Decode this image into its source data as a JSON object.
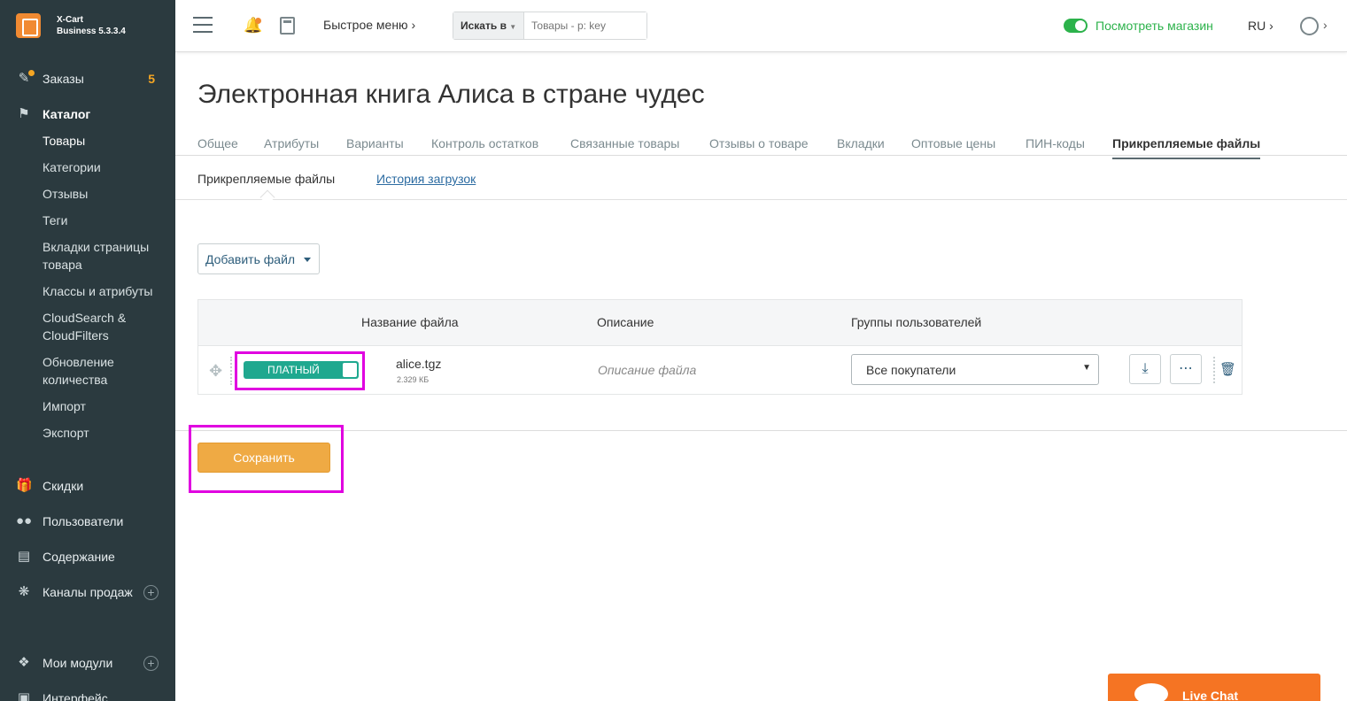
{
  "brand": {
    "line1": "X-Cart",
    "line2": "Business 5.3.3.4"
  },
  "sidebar": {
    "orders": {
      "label": "Заказы",
      "count": "5"
    },
    "catalog": {
      "label": "Каталог"
    },
    "catalog_items": [
      "Товары",
      "Категории",
      "Отзывы",
      "Теги",
      "Вкладки страницы товара",
      "Классы и атрибуты",
      "CloudSearch & CloudFilters",
      "Обновление количества",
      "Импорт",
      "Экспорт"
    ],
    "discounts": "Скидки",
    "users": "Пользователи",
    "content": "Содержание",
    "channels": "Каналы продаж",
    "modules": "Мои модули",
    "interface": "Интерфейс"
  },
  "topbar": {
    "quick_menu": "Быстрое меню",
    "search_in": "Искать в",
    "search_placeholder": "Товары - p: key",
    "view_store": "Посмотреть магазин",
    "lang": "RU"
  },
  "page": {
    "title": "Электронная книга Алиса в стране чудес",
    "tabs": [
      "Общее",
      "Атрибуты",
      "Варианты",
      "Контроль остатков",
      "Связанные товары",
      "Отзывы о товаре",
      "Вкладки",
      "Оптовые цены",
      "ПИН-коды",
      "Прикрепляемые файлы"
    ],
    "subtabs": {
      "current": "Прикрепляемые файлы",
      "history": "История загрузок"
    },
    "add_file": "Добавить файл"
  },
  "table": {
    "headers": {
      "filename": "Название файла",
      "description": "Описание",
      "groups": "Группы пользователей"
    },
    "rows": [
      {
        "paid_label": "ПЛАТНЫЙ",
        "filename": "alice.tgz",
        "size": "2.329 КБ",
        "description_placeholder": "Описание файла",
        "group": "Все покупатели"
      }
    ]
  },
  "save": "Сохранить",
  "livechat": "Live Chat",
  "colors": {
    "sidebar": "#2b3a3f",
    "accent": "#f18a32",
    "green": "#2cb24b",
    "teal": "#1fa88f",
    "save": "#efaa44",
    "highlight": "#e000e0"
  }
}
